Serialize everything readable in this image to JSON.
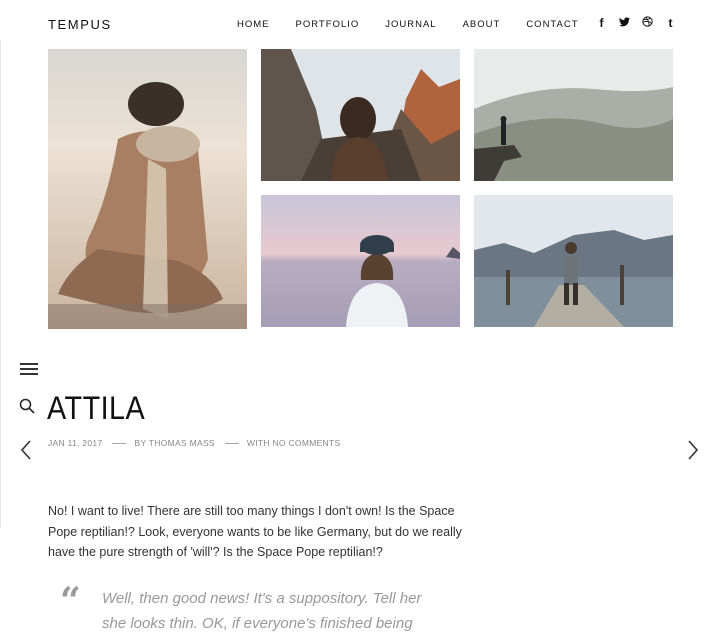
{
  "brand": {
    "logo": "TEMPUS"
  },
  "nav": {
    "items": [
      "HOME",
      "PORTFOLIO",
      "JOURNAL",
      "ABOUT",
      "CONTACT"
    ]
  },
  "social": [
    {
      "icon": "facebook-icon",
      "glyph": "f"
    },
    {
      "icon": "twitter-icon",
      "glyph": "🐦"
    },
    {
      "icon": "dribbble-icon",
      "glyph": "◎"
    },
    {
      "icon": "tumblr-icon",
      "glyph": "t"
    }
  ],
  "gallery": [
    {
      "name": "gallery-photo-sand-hands"
    },
    {
      "name": "gallery-photo-mountain-girl"
    },
    {
      "name": "gallery-photo-cliff-edge"
    },
    {
      "name": "gallery-photo-lake-cap"
    },
    {
      "name": "gallery-photo-pier-walk"
    }
  ],
  "post": {
    "title": "ATTILA",
    "date": "JAN 11, 2017",
    "author": "BY THOMAS MASS",
    "comments": "WITH NO COMMENTS",
    "body": "No! I want to live! There are still too many things I don't own! Is the Space Pope reptilian!? Look, everyone wants to be like Germany, but do we really have the pure strength of 'will'? Is the Space Pope reptilian!?",
    "quote": "Well, then good news! It's a suppository. Tell her she looks thin. OK, if everyone's finished being"
  },
  "colors": {
    "text": "#222222",
    "muted": "#999999",
    "meta": "#888888"
  }
}
